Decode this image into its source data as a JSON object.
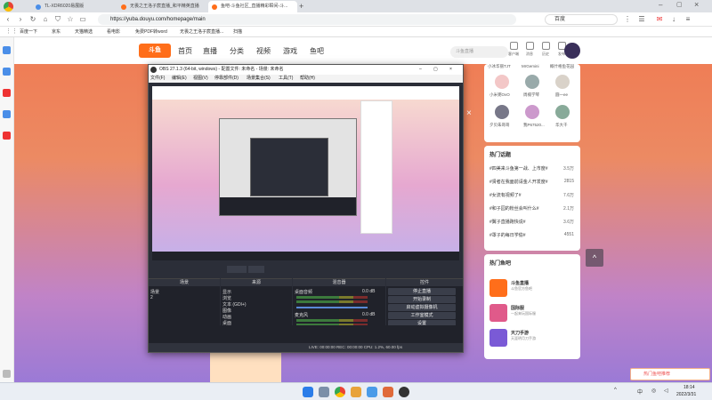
{
  "tabs": [
    {
      "label": "TL-XDR6020易展版",
      "color": "#4a8ee8"
    },
    {
      "label": "无畏之王洛子宸直播_和平精英直播",
      "color": "#ff6e1a"
    },
    {
      "label": "鱼吧-斗鱼社区_直播精彩瞬间-斗...",
      "color": "#ff6e1a"
    }
  ],
  "url": "https://yuba.douyu.com/homepage/main",
  "browser_search": "百度",
  "bookmarks": [
    "百度一下",
    "京东",
    "天猫精选",
    "看电影",
    "免费PDF转word",
    "无畏之王洛子宸直播...",
    "扫描"
  ],
  "site": {
    "logo": "斗鱼",
    "nav": [
      "首页",
      "直播",
      "分类",
      "视频",
      "游戏",
      "鱼吧"
    ],
    "search_placeholder": "斗鱼直播",
    "header_icons": [
      "客户端",
      "消息",
      "历史",
      "发布",
      "个人"
    ]
  },
  "users": [
    "小冰华丽TJT",
    "MrGemini",
    "概什格鱼花园",
    "小米粥OvO",
    "周楠学琴",
    "圆一ee",
    "夕贝朱哥哥",
    "我P67520...",
    "华大千"
  ],
  "hot_topics_title": "热门话题",
  "hot_topics": [
    {
      "t": "#四美来斗鱼第一战、上市度#",
      "c": "3.5万"
    },
    {
      "t": "#贤者在我面前请金人开发度#",
      "c": "2815"
    },
    {
      "t": "#女流有视频了#",
      "c": "7.6万"
    },
    {
      "t": "#和子园的粉丝会叫什么#",
      "c": "2.1万"
    },
    {
      "t": "#翼子直播跑快说#",
      "c": "3.6万"
    },
    {
      "t": "#罩子的每日学偷#",
      "c": "4551"
    }
  ],
  "hot_bars_title": "热门鱼吧",
  "hot_bars": [
    {
      "n": "斗鱼直播",
      "d": "斗鱼官方鱼吧",
      "color": "#ff6e1a"
    },
    {
      "n": "国际服",
      "d": "一起来玩国际服",
      "color": "#e05a8a"
    },
    {
      "n": "天刀手游",
      "d": "天涯明月刀手游",
      "color": "#7a5ad6"
    }
  ],
  "obs": {
    "title": "OBS 27.1.3 (64-bit, windows) - 配置文件: 未命名 - 场景: 未命名",
    "menu": [
      "文件(F)",
      "编辑(E)",
      "视图(V)",
      "停靠部件(D)",
      "场景集合(S)",
      "工具(T)",
      "帮助(H)"
    ],
    "scenes_title": "场景",
    "scenes": [
      "场景",
      "2"
    ],
    "sources_title": "来源",
    "sources": [
      "显示",
      "浏览",
      "文本 (GDI+)",
      "图像",
      "动画",
      "桌面"
    ],
    "mixer_title": "混音器",
    "mixer": [
      {
        "n": "桌面音频",
        "v": "0.0 dB"
      },
      {
        "n": "麦克风",
        "v": "0.0 dB"
      }
    ],
    "controls_title": "控件",
    "controls": [
      "停止直播",
      "开始录制",
      "启动虚拟摄像机",
      "工作室模式",
      "设置",
      "退出"
    ],
    "status": "LIVE: 00:00:00   REC: 00:00:00   CPU: 1.2%, 60.00 fps"
  },
  "promo": "热门鱼吧推荐",
  "time": "18:14",
  "date": "2022/3/31"
}
